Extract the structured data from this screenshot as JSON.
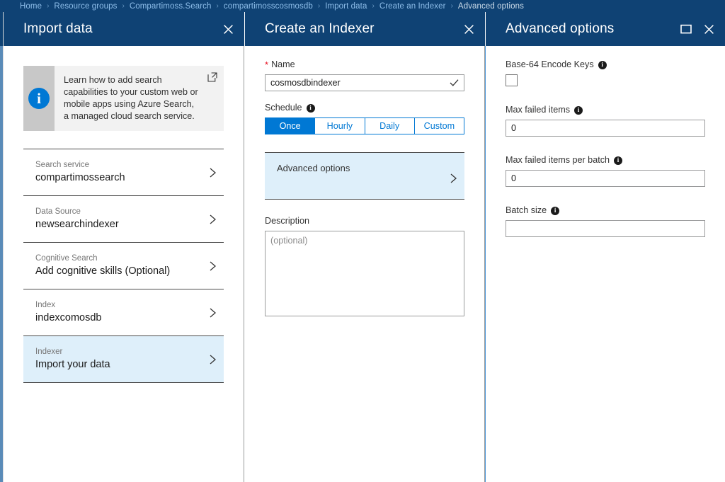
{
  "breadcrumb": {
    "separator": "›",
    "items": [
      {
        "label": "Home",
        "current": false
      },
      {
        "label": "Resource groups",
        "current": false
      },
      {
        "label": "Compartimoss.Search",
        "current": false
      },
      {
        "label": "compartimosscosmosdb",
        "current": false
      },
      {
        "label": "Import data",
        "current": false
      },
      {
        "label": "Create an Indexer",
        "current": false
      },
      {
        "label": "Advanced options",
        "current": true
      }
    ]
  },
  "colors": {
    "header_blue": "#0f4274",
    "accent_blue": "#0078d4",
    "selected_row": "#deeffa",
    "required_red": "#e81123",
    "link_blue": "#8ebeea"
  },
  "blade_import": {
    "title": "Import data",
    "close_label": "Close",
    "banner": {
      "text": "Learn how to add search capabilities to your custom web or mobile apps using Azure Search, a managed cloud search service.",
      "icon": "info-icon",
      "link_icon": "external-link-icon"
    },
    "steps": [
      {
        "label": "Search service",
        "value": "compartimossearch",
        "selected": false
      },
      {
        "label": "Data Source",
        "value": "newsearchindexer",
        "selected": false
      },
      {
        "label": "Cognitive Search",
        "value": "Add cognitive skills (Optional)",
        "selected": false
      },
      {
        "label": "Index",
        "value": "indexcomosdb",
        "selected": false
      },
      {
        "label": "Indexer",
        "value": "Import your data",
        "selected": true
      }
    ]
  },
  "blade_indexer": {
    "title": "Create an Indexer",
    "close_label": "Close",
    "name_field": {
      "label": "Name",
      "required_marker": "*",
      "value": "cosmosdbindexer",
      "placeholder": "",
      "validated": true
    },
    "schedule": {
      "label": "Schedule",
      "options": [
        "Once",
        "Hourly",
        "Daily",
        "Custom"
      ],
      "selected": "Once"
    },
    "advanced_row": {
      "label": "Advanced options"
    },
    "description": {
      "label": "Description",
      "value": "",
      "placeholder": "(optional)"
    }
  },
  "blade_advanced": {
    "title": "Advanced options",
    "maximize_label": "Maximize",
    "close_label": "Close",
    "base64": {
      "label": "Base-64 Encode Keys",
      "checked": false
    },
    "max_failed_items": {
      "label": "Max failed items",
      "value": "0",
      "placeholder": ""
    },
    "max_failed_items_per_batch": {
      "label": "Max failed items per batch",
      "value": "0",
      "placeholder": ""
    },
    "batch_size": {
      "label": "Batch size",
      "value": "",
      "placeholder": ""
    }
  }
}
